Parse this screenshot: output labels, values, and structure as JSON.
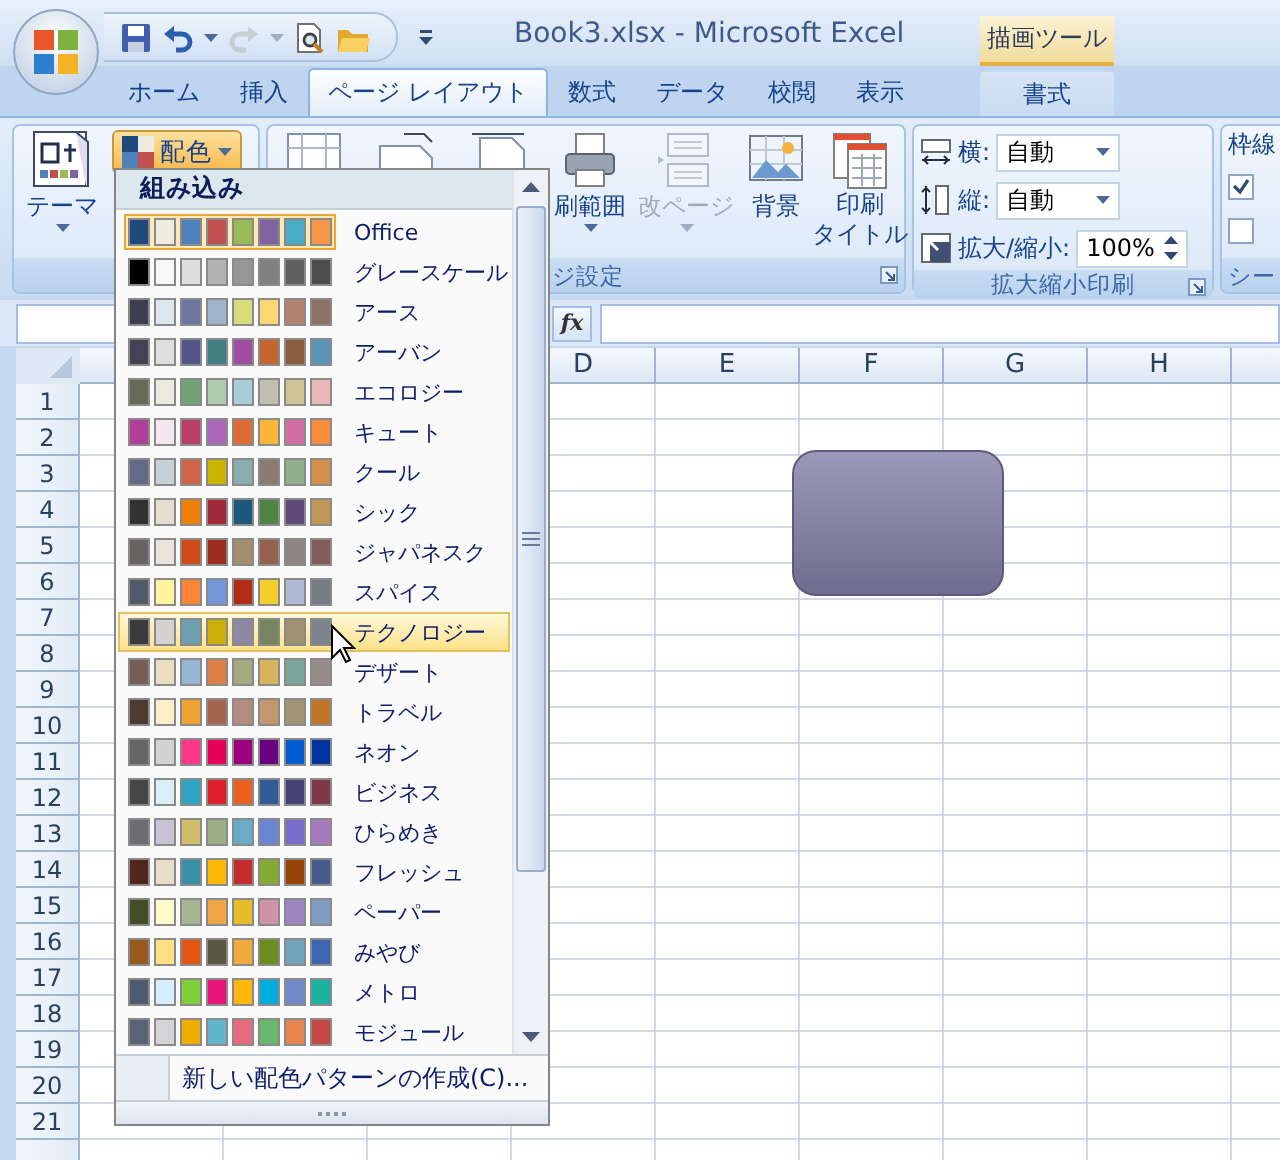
{
  "window": {
    "title": "Book3.xlsx - Microsoft Excel"
  },
  "quick_access": [
    {
      "kind": "save",
      "disabled": false
    },
    {
      "kind": "undo",
      "disabled": false
    },
    {
      "kind": "redo",
      "disabled": true
    },
    {
      "kind": "print_preview",
      "disabled": false
    },
    {
      "kind": "open",
      "disabled": false
    }
  ],
  "contextual_tab_group": {
    "title": "描画ツール",
    "tabs": [
      {
        "label": "書式",
        "selected": false
      }
    ]
  },
  "tabs": [
    {
      "label": "ホーム",
      "selected": false
    },
    {
      "label": "挿入",
      "selected": false
    },
    {
      "label": "ページ レイアウト",
      "selected": true
    },
    {
      "label": "数式",
      "selected": false
    },
    {
      "label": "データ",
      "selected": false
    },
    {
      "label": "校閲",
      "selected": false
    },
    {
      "label": "表示",
      "selected": false
    }
  ],
  "ribbon": {
    "themes_group": {
      "themes_button": "テーマ",
      "colors_button": {
        "label": "配色",
        "pressed": true
      }
    },
    "page_setup_group": {
      "buttons": [
        {
          "kind": "print_area",
          "label_lines": [
            "刷範囲"
          ],
          "disabled": false
        },
        {
          "kind": "breaks",
          "label_lines": [
            "改ページ"
          ],
          "disabled": true
        },
        {
          "kind": "background",
          "label_lines": [
            "背景"
          ],
          "disabled": false
        },
        {
          "kind": "print_titles",
          "label_lines": [
            "印刷",
            "タイトル"
          ],
          "disabled": false
        }
      ],
      "title": "ジ設定"
    },
    "scale_group": {
      "rows": [
        {
          "kind": "dropdown",
          "label": "横:",
          "value": "自動"
        },
        {
          "kind": "dropdown",
          "label": "縦:",
          "value": "自動"
        },
        {
          "kind": "spinner",
          "label": "拡大/縮小:",
          "value": "100%"
        }
      ],
      "title": "拡大縮小印刷"
    },
    "sheet_options_group": {
      "heading": "枠線",
      "checks": [
        {
          "checked": true
        },
        {
          "checked": false
        }
      ],
      "title": "シー"
    }
  },
  "formula_bar": {
    "function_button": "fx"
  },
  "sheet": {
    "columns": [
      "D",
      "E",
      "F",
      "G",
      "H"
    ],
    "rows": [
      "1",
      "2",
      "3",
      "4",
      "5",
      "6",
      "7",
      "8",
      "9",
      "10",
      "11",
      "12",
      "13",
      "14",
      "15",
      "16",
      "17",
      "18",
      "19",
      "20",
      "21"
    ]
  },
  "color_menu": {
    "header": "組み込み",
    "schemes": [
      {
        "name": "Office",
        "selected": true,
        "highlighted": false,
        "swatches": [
          {
            "color": "#1f497d"
          },
          {
            "color": "#eeece1"
          },
          {
            "color": "#4f81bd"
          },
          {
            "color": "#c0504d"
          },
          {
            "color": "#9bbb59"
          },
          {
            "color": "#8064a2"
          },
          {
            "color": "#4bacc6"
          },
          {
            "color": "#f79646"
          }
        ]
      },
      {
        "name": "グレースケール",
        "selected": false,
        "highlighted": false,
        "swatches": [
          {
            "color": "#000000"
          },
          {
            "color": "#f8f8f8"
          },
          {
            "color": "#dddddd"
          },
          {
            "color": "#b2b2b2"
          },
          {
            "color": "#969696"
          },
          {
            "color": "#808080"
          },
          {
            "color": "#5f5f5f"
          },
          {
            "color": "#4d4d4d"
          }
        ]
      },
      {
        "name": "アース",
        "selected": false,
        "highlighted": false,
        "swatches": [
          {
            "color": "#3f3e4e"
          },
          {
            "color": "#dde8ee"
          },
          {
            "color": "#71749f"
          },
          {
            "color": "#9eb6cc"
          },
          {
            "color": "#d6dc7a"
          },
          {
            "color": "#fbd875"
          },
          {
            "color": "#b4826f"
          },
          {
            "color": "#8f7268"
          }
        ]
      },
      {
        "name": "アーバン",
        "selected": false,
        "highlighted": false,
        "swatches": [
          {
            "color": "#424456"
          },
          {
            "color": "#dedede"
          },
          {
            "color": "#53548a"
          },
          {
            "color": "#438086"
          },
          {
            "color": "#a04da3"
          },
          {
            "color": "#c4652d"
          },
          {
            "color": "#8b5d3d"
          },
          {
            "color": "#5c92b5"
          }
        ]
      },
      {
        "name": "エコロジー",
        "selected": false,
        "highlighted": false,
        "swatches": [
          {
            "color": "#676a55"
          },
          {
            "color": "#eaebde"
          },
          {
            "color": "#72a376"
          },
          {
            "color": "#b0ccb0"
          },
          {
            "color": "#a8cdd7"
          },
          {
            "color": "#c0beaf"
          },
          {
            "color": "#cec597"
          },
          {
            "color": "#e8b7b7"
          }
        ]
      },
      {
        "name": "キュート",
        "selected": false,
        "highlighted": false,
        "swatches": [
          {
            "color": "#b13f9a"
          },
          {
            "color": "#f4e7ed"
          },
          {
            "color": "#b83d68"
          },
          {
            "color": "#ac66bb"
          },
          {
            "color": "#de6c36"
          },
          {
            "color": "#f9b639"
          },
          {
            "color": "#cf6da4"
          },
          {
            "color": "#fa8d3d"
          }
        ]
      },
      {
        "name": "クール",
        "selected": false,
        "highlighted": false,
        "swatches": [
          {
            "color": "#646b86"
          },
          {
            "color": "#c5d1d7"
          },
          {
            "color": "#d16349"
          },
          {
            "color": "#ccb400"
          },
          {
            "color": "#8cadae"
          },
          {
            "color": "#8c7b70"
          },
          {
            "color": "#8fb08c"
          },
          {
            "color": "#d19049"
          }
        ]
      },
      {
        "name": "シック",
        "selected": false,
        "highlighted": false,
        "swatches": [
          {
            "color": "#323232"
          },
          {
            "color": "#e3ded1"
          },
          {
            "color": "#f07f09"
          },
          {
            "color": "#9f2936"
          },
          {
            "color": "#1b587c"
          },
          {
            "color": "#4e8542"
          },
          {
            "color": "#604878"
          },
          {
            "color": "#c19859"
          }
        ]
      },
      {
        "name": "ジャパネスク",
        "selected": false,
        "highlighted": false,
        "swatches": [
          {
            "color": "#696464"
          },
          {
            "color": "#e9e5dc"
          },
          {
            "color": "#d34817"
          },
          {
            "color": "#9b2d1f"
          },
          {
            "color": "#a28e6a"
          },
          {
            "color": "#956251"
          },
          {
            "color": "#918485"
          },
          {
            "color": "#855d5d"
          }
        ]
      },
      {
        "name": "スパイス",
        "selected": false,
        "highlighted": false,
        "swatches": [
          {
            "color": "#525a69"
          },
          {
            "color": "#fff39d"
          },
          {
            "color": "#fe8637"
          },
          {
            "color": "#7598d9"
          },
          {
            "color": "#b32c16"
          },
          {
            "color": "#f5cd2d"
          },
          {
            "color": "#aebad5"
          },
          {
            "color": "#777c84"
          }
        ]
      },
      {
        "name": "テクノロジー",
        "selected": false,
        "highlighted": true,
        "swatches": [
          {
            "color": "#3b3b3b"
          },
          {
            "color": "#d4d2d0"
          },
          {
            "color": "#6ea0b0"
          },
          {
            "color": "#ccaf0a"
          },
          {
            "color": "#8d89a4"
          },
          {
            "color": "#748560"
          },
          {
            "color": "#9e9273"
          },
          {
            "color": "#7e848d"
          }
        ]
      },
      {
        "name": "デザート",
        "selected": false,
        "highlighted": false,
        "swatches": [
          {
            "color": "#775f55"
          },
          {
            "color": "#ebddc3"
          },
          {
            "color": "#94b6d2"
          },
          {
            "color": "#dd8047"
          },
          {
            "color": "#a5ab81"
          },
          {
            "color": "#d8b25c"
          },
          {
            "color": "#7ba79d"
          },
          {
            "color": "#968c8c"
          }
        ]
      },
      {
        "name": "トラベル",
        "selected": false,
        "highlighted": false,
        "swatches": [
          {
            "color": "#4e3b30"
          },
          {
            "color": "#fbeec9"
          },
          {
            "color": "#f0a22e"
          },
          {
            "color": "#a5644e"
          },
          {
            "color": "#b58b80"
          },
          {
            "color": "#c3986d"
          },
          {
            "color": "#a19574"
          },
          {
            "color": "#c17529"
          }
        ]
      },
      {
        "name": "ネオン",
        "selected": false,
        "highlighted": false,
        "swatches": [
          {
            "color": "#666666"
          },
          {
            "color": "#d2d2d2"
          },
          {
            "color": "#ff388c"
          },
          {
            "color": "#e40059"
          },
          {
            "color": "#9c007f"
          },
          {
            "color": "#68007f"
          },
          {
            "color": "#005bd3"
          },
          {
            "color": "#00349e"
          }
        ]
      },
      {
        "name": "ビジネス",
        "selected": false,
        "highlighted": false,
        "swatches": [
          {
            "color": "#464646"
          },
          {
            "color": "#dbeff9"
          },
          {
            "color": "#31a4c5"
          },
          {
            "color": "#de202d"
          },
          {
            "color": "#ea6121"
          },
          {
            "color": "#335a99"
          },
          {
            "color": "#434378"
          },
          {
            "color": "#813849"
          }
        ]
      },
      {
        "name": "ひらめき",
        "selected": false,
        "highlighted": false,
        "swatches": [
          {
            "color": "#6e6e72"
          },
          {
            "color": "#c8c3d6"
          },
          {
            "color": "#d0bd6b"
          },
          {
            "color": "#9caf84"
          },
          {
            "color": "#6aacc8"
          },
          {
            "color": "#6b86d1"
          },
          {
            "color": "#7a6ccc"
          },
          {
            "color": "#a57abf"
          }
        ]
      },
      {
        "name": "フレッシュ",
        "selected": false,
        "highlighted": false,
        "swatches": [
          {
            "color": "#4f271c"
          },
          {
            "color": "#e7dec9"
          },
          {
            "color": "#3891a7"
          },
          {
            "color": "#feb80a"
          },
          {
            "color": "#c32d2e"
          },
          {
            "color": "#84aa33"
          },
          {
            "color": "#964305"
          },
          {
            "color": "#475a8d"
          }
        ]
      },
      {
        "name": "ペーパー",
        "selected": false,
        "highlighted": false,
        "swatches": [
          {
            "color": "#444d26"
          },
          {
            "color": "#fefac9"
          },
          {
            "color": "#a5b592"
          },
          {
            "color": "#f3a447"
          },
          {
            "color": "#e7bc29"
          },
          {
            "color": "#d092a7"
          },
          {
            "color": "#9c85c0"
          },
          {
            "color": "#809ec2"
          }
        ]
      },
      {
        "name": "みやび",
        "selected": false,
        "highlighted": false,
        "swatches": [
          {
            "color": "#985a1f"
          },
          {
            "color": "#ffe082"
          },
          {
            "color": "#e5580f"
          },
          {
            "color": "#575744"
          },
          {
            "color": "#f2a93c"
          },
          {
            "color": "#6b8e1d"
          },
          {
            "color": "#72a6bf"
          },
          {
            "color": "#3d66b2"
          }
        ]
      },
      {
        "name": "メトロ",
        "selected": false,
        "highlighted": false,
        "swatches": [
          {
            "color": "#4e5b6f"
          },
          {
            "color": "#d6ecff"
          },
          {
            "color": "#7fd13b"
          },
          {
            "color": "#ea157a"
          },
          {
            "color": "#feb80a"
          },
          {
            "color": "#00addc"
          },
          {
            "color": "#738ac8"
          },
          {
            "color": "#1ab39f"
          }
        ]
      },
      {
        "name": "モジュール",
        "selected": false,
        "highlighted": false,
        "swatches": [
          {
            "color": "#5a6378"
          },
          {
            "color": "#d4d4d6"
          },
          {
            "color": "#f0ad00"
          },
          {
            "color": "#60b5cc"
          },
          {
            "color": "#e66c7d"
          },
          {
            "color": "#6bb76d"
          },
          {
            "color": "#e88651"
          },
          {
            "color": "#c64847"
          }
        ]
      }
    ],
    "footer": "新しい配色パターンの作成(C)..."
  }
}
